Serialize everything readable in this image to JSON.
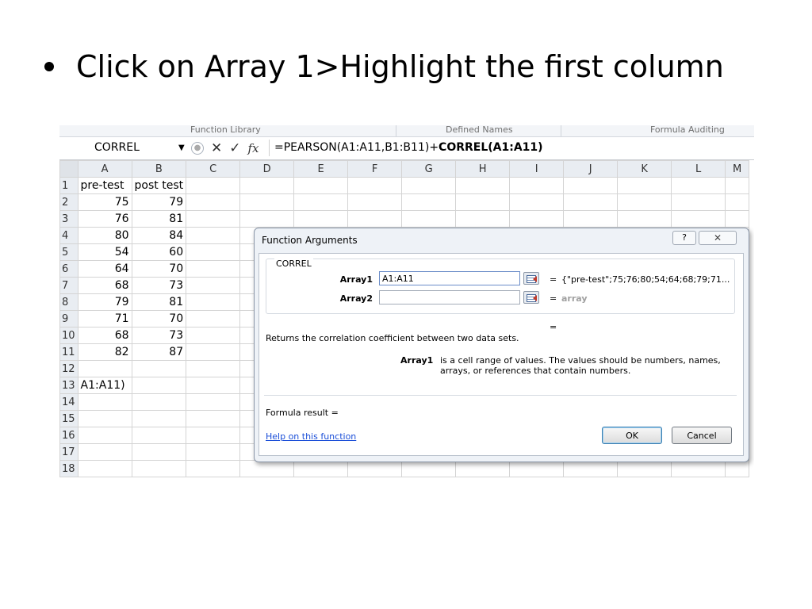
{
  "slide": {
    "bullet_text": "Click on Array 1>Highlight the first column"
  },
  "ribbon": {
    "groups": [
      "Function Library",
      "Defined Names",
      "Formula Auditing"
    ]
  },
  "formula_bar": {
    "name_box": "CORREL",
    "formula_prefix": "=PEARSON(A1:A11,B1:B11)+",
    "formula_active": "CORREL(A1:A11)"
  },
  "sheet": {
    "columns": [
      "A",
      "B",
      "C",
      "D",
      "E",
      "F",
      "G",
      "H",
      "I",
      "J",
      "K",
      "L",
      "M"
    ],
    "rows": [
      {
        "num": "1",
        "a": "pre-test",
        "b": "post test"
      },
      {
        "num": "2",
        "a": "75",
        "b": "79"
      },
      {
        "num": "3",
        "a": "76",
        "b": "81"
      },
      {
        "num": "4",
        "a": "80",
        "b": "84"
      },
      {
        "num": "5",
        "a": "54",
        "b": "60"
      },
      {
        "num": "6",
        "a": "64",
        "b": "70"
      },
      {
        "num": "7",
        "a": "68",
        "b": "73"
      },
      {
        "num": "8",
        "a": "79",
        "b": "81"
      },
      {
        "num": "9",
        "a": "71",
        "b": "70"
      },
      {
        "num": "10",
        "a": "68",
        "b": "73"
      },
      {
        "num": "11",
        "a": "82",
        "b": "87"
      },
      {
        "num": "12",
        "a": "",
        "b": ""
      },
      {
        "num": "13",
        "a": "A1:A11)",
        "b": ""
      },
      {
        "num": "14",
        "a": "",
        "b": ""
      },
      {
        "num": "15",
        "a": "",
        "b": ""
      },
      {
        "num": "16",
        "a": "",
        "b": ""
      },
      {
        "num": "17",
        "a": "",
        "b": ""
      },
      {
        "num": "18",
        "a": "",
        "b": ""
      }
    ]
  },
  "dialog": {
    "title": "Function Arguments",
    "help_glyph": "?",
    "close_glyph": "✕",
    "function_name": "CORREL",
    "array1_label": "Array1",
    "array1_value": "A1:A11",
    "array1_result": "{\"pre-test\";75;76;80;54;64;68;79;71...",
    "array2_label": "Array2",
    "array2_value": "",
    "array2_result": "array",
    "equals": "=",
    "description": "Returns the correlation coefficient between two data sets.",
    "arg_help_name": "Array1",
    "arg_help_text": "is a cell range of values. The values should be numbers, names, arrays, or references that contain numbers.",
    "formula_result": "Formula result =",
    "help_link": "Help on this function",
    "ok_label": "OK",
    "cancel_label": "Cancel"
  }
}
